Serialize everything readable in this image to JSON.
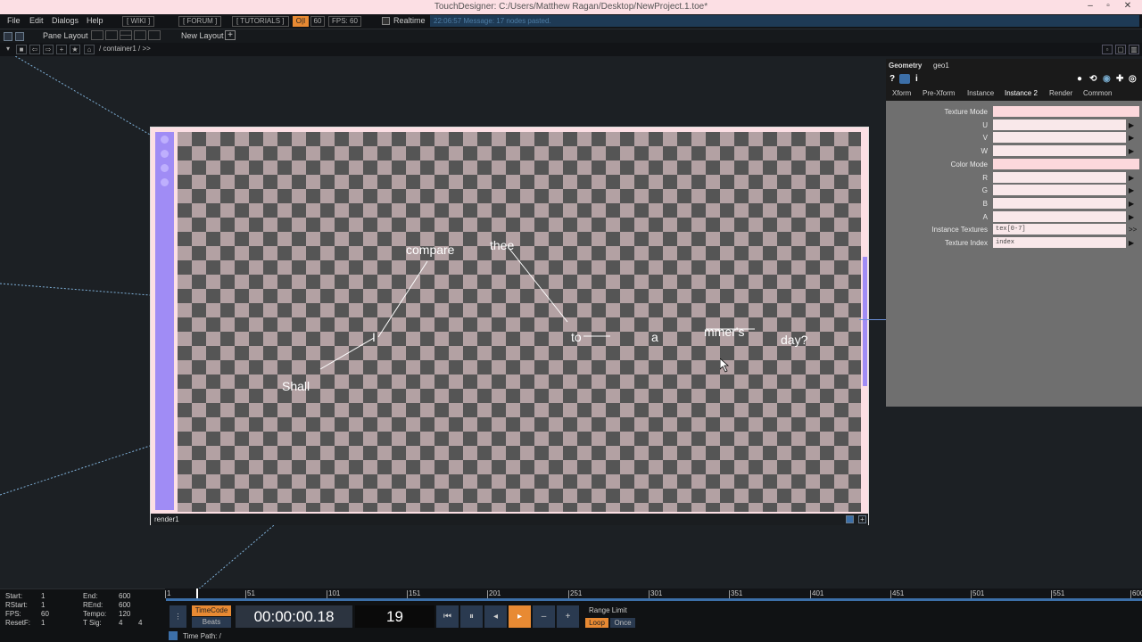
{
  "window": {
    "title": "TouchDesigner: C:/Users/Matthew Ragan/Desktop/NewProject.1.toe*",
    "controls": [
      "–",
      "▫",
      "✕"
    ]
  },
  "menu": {
    "items": [
      "File",
      "Edit",
      "Dialogs",
      "Help"
    ],
    "wiki": "[ WIKI ]",
    "forum": "[ FORUM ]",
    "tutorials": "[ TUTORIALS ]",
    "oi": "O|I",
    "fps_value": "60",
    "fps_label": "FPS: 60",
    "realtime": "Realtime",
    "message": "22:06:57 Message: 17 nodes pasted."
  },
  "pane": {
    "pane_layout": "Pane Layout",
    "new_layout": "New Layout",
    "plus": "+"
  },
  "path": {
    "text": "/ container1 / >>"
  },
  "render": {
    "label": "render1",
    "words": [
      {
        "text": "compare"
      },
      {
        "text": "thee"
      },
      {
        "text": "I"
      },
      {
        "text": "to"
      },
      {
        "text": "a"
      },
      {
        "text": "mmer's"
      },
      {
        "text": "day?"
      },
      {
        "text": "Shall"
      }
    ]
  },
  "params": {
    "type": "Geometry",
    "name": "geo1",
    "tabs": [
      "Xform",
      "Pre-Xform",
      "Instance",
      "Instance 2",
      "Render",
      "Common"
    ],
    "active_tab": "Instance 2",
    "rows": [
      {
        "label": "Texture Mode",
        "value": "",
        "arrow": ""
      },
      {
        "label": "U",
        "value": "",
        "arrow": "▶"
      },
      {
        "label": "V",
        "value": "",
        "arrow": "▶"
      },
      {
        "label": "W",
        "value": "",
        "arrow": "▶"
      },
      {
        "label": "Color Mode",
        "value": "",
        "arrow": ""
      },
      {
        "label": "R",
        "value": "",
        "arrow": "▶"
      },
      {
        "label": "G",
        "value": "",
        "arrow": "▶"
      },
      {
        "label": "B",
        "value": "",
        "arrow": "▶"
      },
      {
        "label": "A",
        "value": "",
        "arrow": "▶"
      },
      {
        "label": "Instance Textures",
        "value": "tex[0-7]",
        "arrow": ">>"
      },
      {
        "label": "Texture Index",
        "value": "index",
        "arrow": "▶"
      }
    ]
  },
  "status": {
    "start": "Start:",
    "start_v": "1",
    "end": "End:",
    "end_v": "600",
    "rstart": "RStart:",
    "rstart_v": "1",
    "rend": "REnd:",
    "rend_v": "600",
    "fps": "FPS:",
    "fps_v": "60",
    "tempo": "Tempo:",
    "tempo_v": "120",
    "resetf": "ResetF:",
    "resetf_v": "1",
    "tsig": "T Sig:",
    "tsig_v1": "4",
    "tsig_v2": "4"
  },
  "timeline": {
    "ticks": [
      "1",
      "51",
      "101",
      "151",
      "201",
      "251",
      "301",
      "351",
      "401",
      "451",
      "501",
      "551",
      "600"
    ],
    "current_frame": 19
  },
  "transport": {
    "timecode": "TimeCode",
    "beats": "Beats",
    "time": "00:00:00.18",
    "frame": "19",
    "range_limit": "Range Limit",
    "loop": "Loop",
    "once": "Once",
    "buttons": [
      "⏮",
      "⏸",
      "◂",
      "▸",
      "–",
      "+"
    ]
  },
  "timepath": {
    "text": "Time Path: /"
  }
}
